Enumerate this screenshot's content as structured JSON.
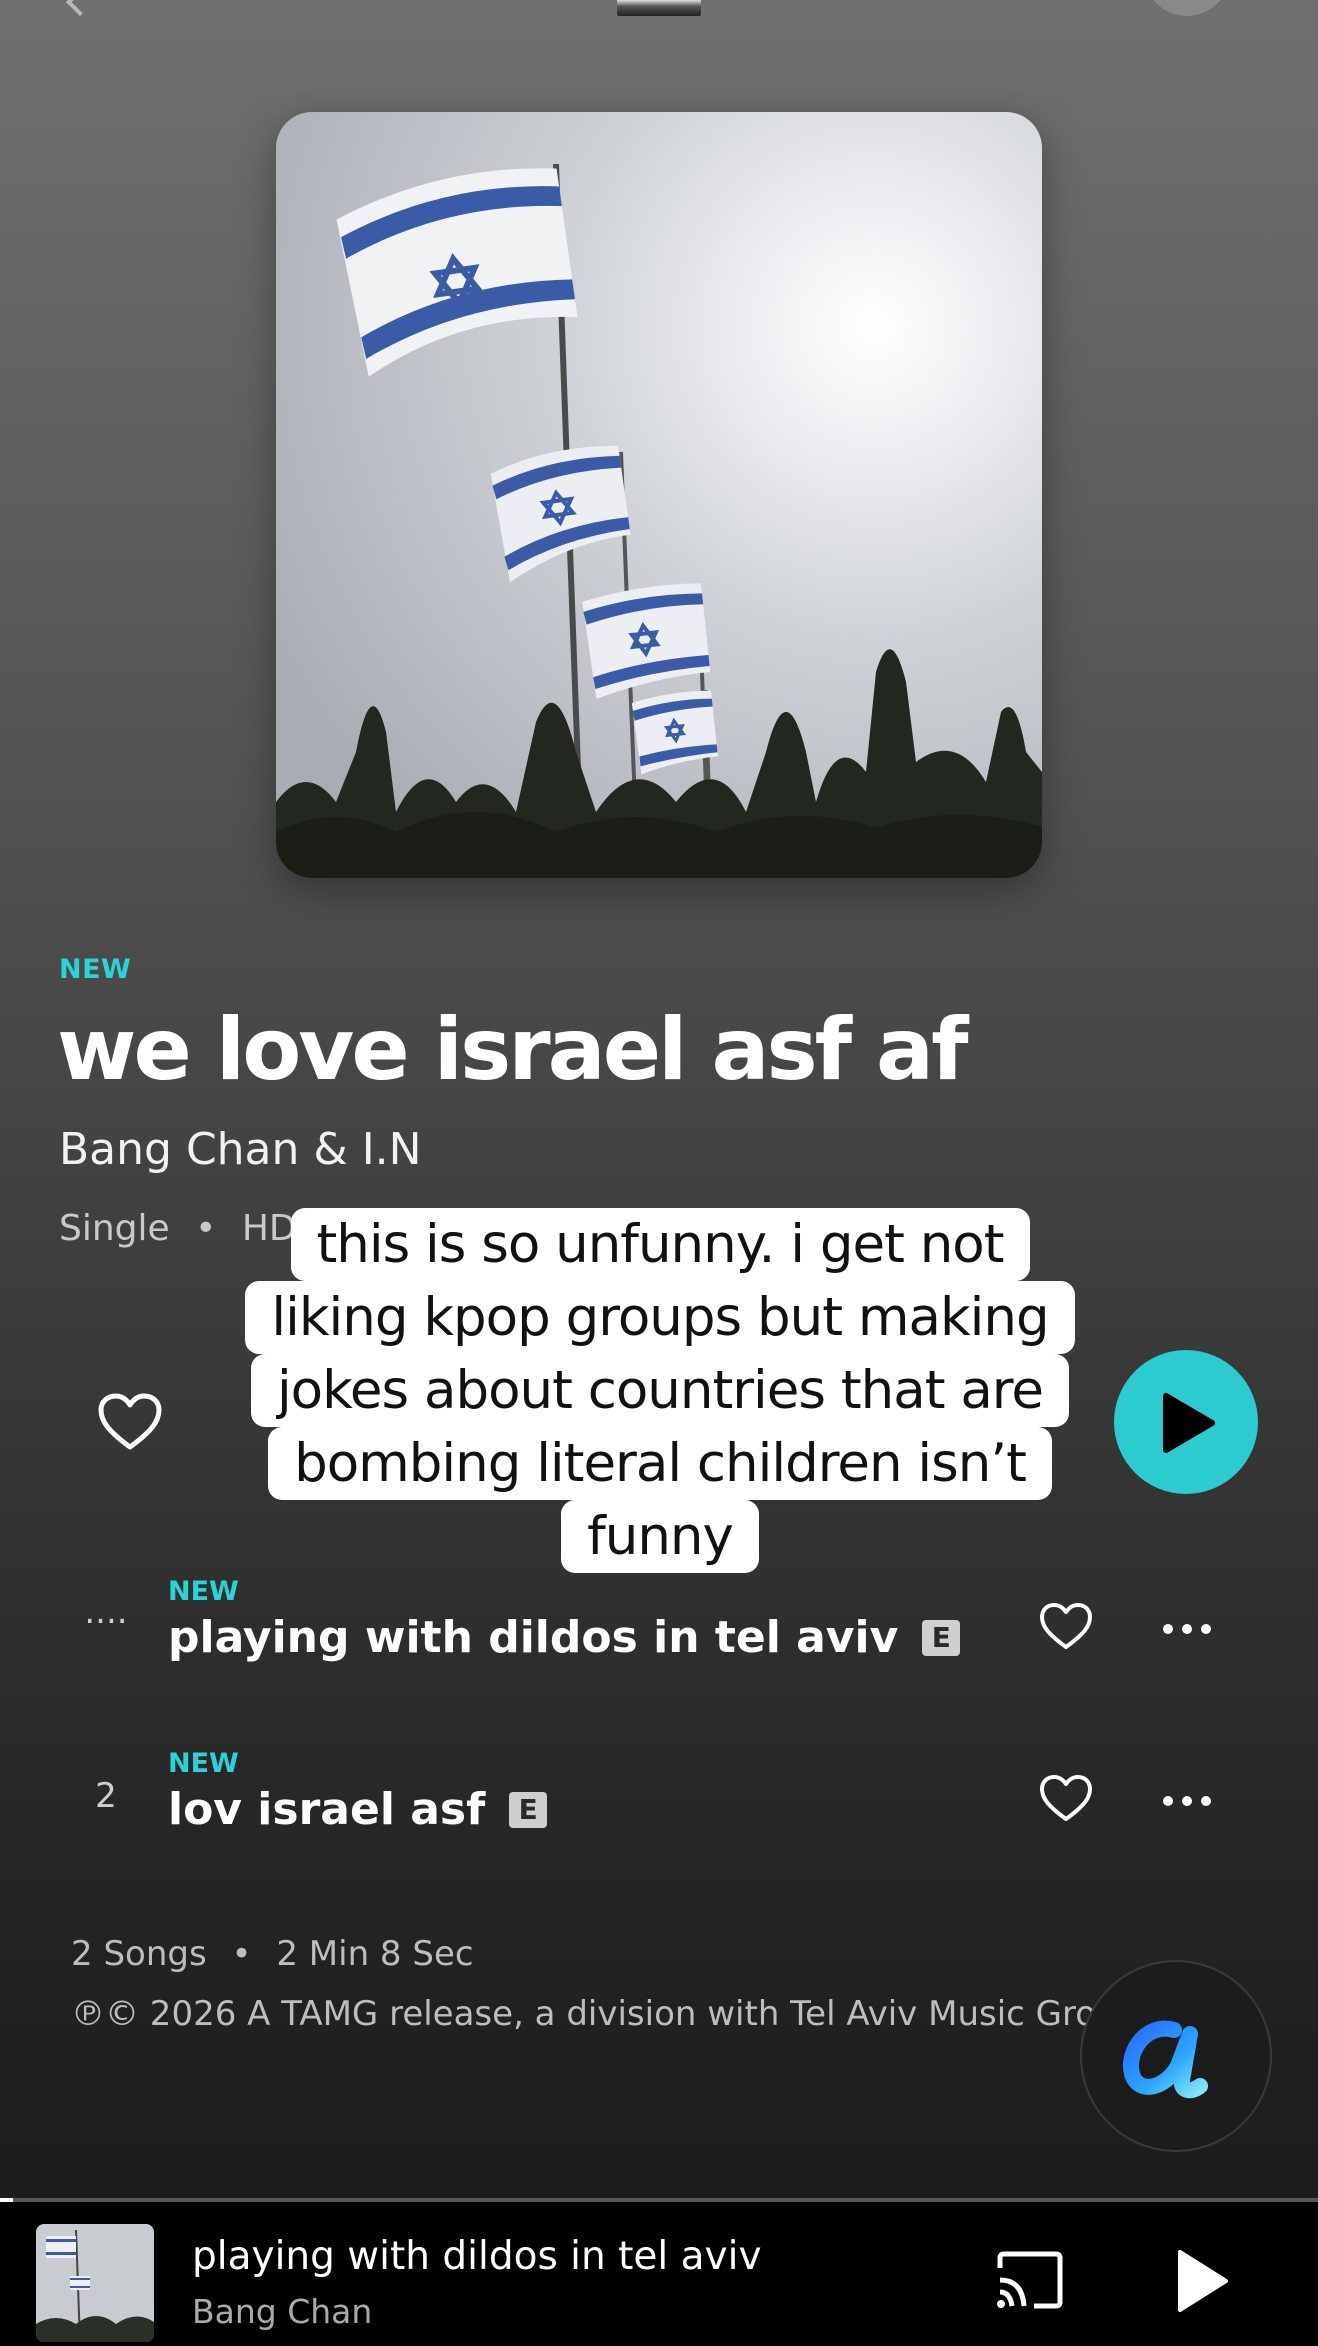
{
  "album": {
    "badge": "NEW",
    "title": "we love israel asf af",
    "artist": "Bang Chan & I.N",
    "type": "Single",
    "quality": "HD"
  },
  "caption": {
    "lines": [
      "this is so unfunny. i get not",
      "liking kpop groups but making",
      "jokes about countries that are",
      "bombing literal children isn’t",
      "funny"
    ]
  },
  "tracks": [
    {
      "number": "....",
      "badge": "NEW",
      "title": "playing with dildos in tel aviv",
      "explicit": "E"
    },
    {
      "number": "2",
      "badge": "NEW",
      "title": "lov israel asf",
      "explicit": "E"
    }
  ],
  "footer": {
    "song_count": "2 Songs",
    "duration": "2 Min 8 Sec",
    "copyright": "℗© 2026 A TAMG release, a division with Tel Aviv Music Group"
  },
  "now_playing": {
    "title": "playing with dildos in tel aviv",
    "artist": "Bang Chan",
    "progress": 0.01
  },
  "colors": {
    "accent": "#2bd3d6",
    "play_button": "#2ccbd0",
    "mini_player_bg": "#000000"
  },
  "icons": {
    "favorite": "heart-outline-icon",
    "play": "play-icon",
    "more": "more-horizontal-icon",
    "cast": "cast-icon",
    "assistant": "alexa-icon"
  }
}
